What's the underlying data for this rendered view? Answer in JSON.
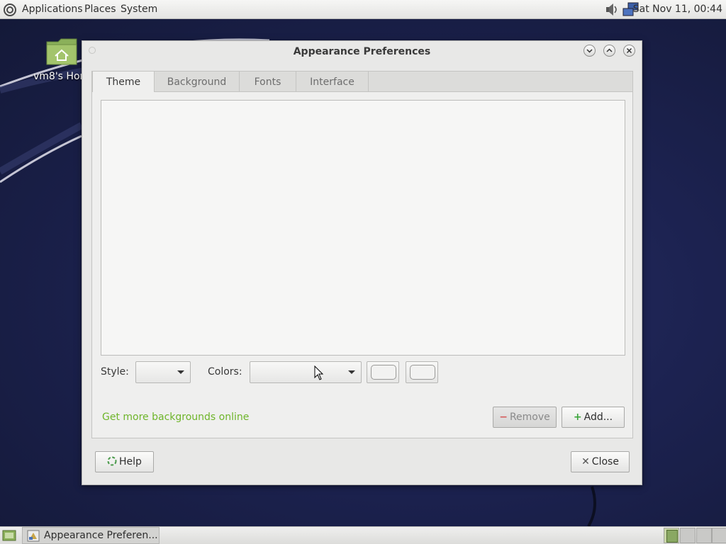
{
  "top_panel": {
    "menus": [
      "Applications",
      "Places",
      "System"
    ],
    "clock": "Sat Nov 11, 00:44"
  },
  "desktop": {
    "home_icon_label": "vm8's Hor"
  },
  "window": {
    "title": "Appearance Preferences",
    "tabs": [
      {
        "label": "Theme"
      },
      {
        "label": "Background"
      },
      {
        "label": "Fonts"
      },
      {
        "label": "Interface"
      }
    ],
    "style_label": "Style:",
    "colors_label": "Colors:",
    "style_value": "",
    "colors_value": "",
    "get_more_link": "Get more backgrounds online",
    "remove_label": "Remove",
    "add_label": "Add...",
    "help_label": "Help",
    "close_label": "Close"
  },
  "taskbar": {
    "item_label": "Appearance Preferen..."
  }
}
